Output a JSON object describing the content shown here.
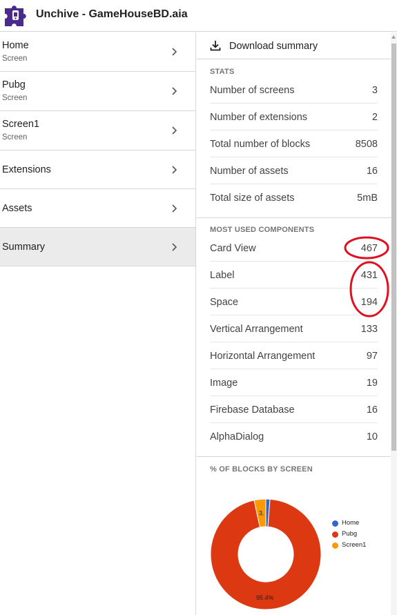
{
  "app": {
    "title": "Unchive - GameHouseBD.aia",
    "logo_icon": "puzzle-piece-icon",
    "logo_color": "#4a2a8c"
  },
  "nav": {
    "items": [
      {
        "label": "Home",
        "sublabel": "Screen",
        "selected": false
      },
      {
        "label": "Pubg",
        "sublabel": "Screen",
        "selected": false
      },
      {
        "label": "Screen1",
        "sublabel": "Screen",
        "selected": false
      },
      {
        "label": "Extensions",
        "sublabel": "",
        "selected": false
      },
      {
        "label": "Assets",
        "sublabel": "",
        "selected": false
      },
      {
        "label": "Summary",
        "sublabel": "",
        "selected": true
      }
    ]
  },
  "summary": {
    "download_label": "Download summary",
    "stats": {
      "title": "STATS",
      "rows": [
        {
          "label": "Number of screens",
          "value": "3"
        },
        {
          "label": "Number of extensions",
          "value": "2"
        },
        {
          "label": "Total number of blocks",
          "value": "8508"
        },
        {
          "label": "Number of assets",
          "value": "16"
        },
        {
          "label": "Total size of assets",
          "value": "5mB"
        }
      ]
    },
    "components": {
      "title": "MOST USED COMPONENTS",
      "rows": [
        {
          "label": "Card View",
          "value": "467"
        },
        {
          "label": "Label",
          "value": "431"
        },
        {
          "label": "Space",
          "value": "194"
        },
        {
          "label": "Vertical Arrangement",
          "value": "133"
        },
        {
          "label": "Horizontal Arrangement",
          "value": "97"
        },
        {
          "label": "Image",
          "value": "19"
        },
        {
          "label": "Firebase Database",
          "value": "16"
        },
        {
          "label": "AlphaDialog",
          "value": "10"
        }
      ]
    },
    "chart_section_title": "% OF BLOCKS BY SCREEN"
  },
  "annotation_color": "#e0101e",
  "chart_data": {
    "type": "pie",
    "donut": true,
    "title": "% OF BLOCKS BY SCREEN",
    "categories": [
      "Home",
      "Pubg",
      "Screen1"
    ],
    "values": [
      1.2,
      95.4,
      3.4
    ],
    "slice_labels": [
      "",
      "95.4%",
      "3."
    ],
    "colors": [
      "#3366cc",
      "#dc3912",
      "#ff9900"
    ],
    "legend_position": "right"
  }
}
